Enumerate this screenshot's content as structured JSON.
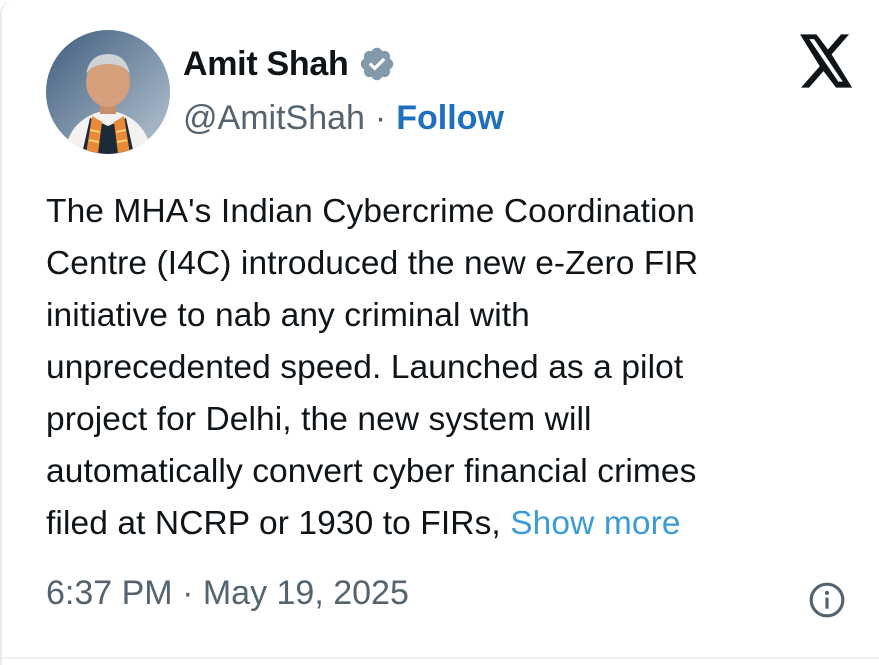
{
  "author": {
    "name": "Amit Shah",
    "handle": "@AmitShah",
    "separator": "·",
    "follow_label": "Follow"
  },
  "tweet": {
    "lines": [
      "The MHA's Indian Cybercrime Coordination",
      "Centre (I4C) introduced the new e-Zero FIR",
      "initiative to nab any criminal with",
      "unprecedented speed. Launched as a pilot",
      "project for Delhi, the new system will",
      "automatically convert cyber financial crimes",
      "filed at NCRP or 1930 to FIRs, "
    ],
    "show_more_label": "Show more"
  },
  "timestamp": "6:37 PM · May 19, 2025",
  "icons": {
    "verified": "verified-badge-icon",
    "brand": "x-logo-icon",
    "info": "info-icon"
  },
  "colors": {
    "text": "#0f1419",
    "secondary": "#536471",
    "follow": "#1d6fbf",
    "link": "#3a9bd6",
    "verified_badge": "#829aab"
  }
}
